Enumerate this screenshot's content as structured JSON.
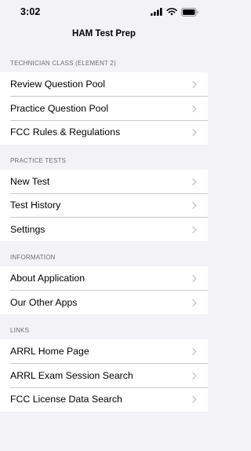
{
  "status_bar": {
    "time": "3:02",
    "icons": [
      "cellular-signal-icon",
      "wifi-icon",
      "battery-icon"
    ]
  },
  "nav": {
    "title": "HAM Test Prep"
  },
  "sections": [
    {
      "header": "TECHNICIAN CLASS (ELEMENT 2)",
      "items": [
        {
          "label": "Review Question Pool"
        },
        {
          "label": "Practice Question Pool"
        },
        {
          "label": "FCC Rules & Regulations"
        }
      ]
    },
    {
      "header": "PRACTICE TESTS",
      "items": [
        {
          "label": "New Test"
        },
        {
          "label": "Test History"
        },
        {
          "label": "Settings"
        }
      ]
    },
    {
      "header": "INFORMATION",
      "items": [
        {
          "label": "About Application"
        },
        {
          "label": "Our Other Apps"
        }
      ]
    },
    {
      "header": "LINKS",
      "items": [
        {
          "label": "ARRL Home Page"
        },
        {
          "label": "ARRL Exam Session Search"
        },
        {
          "label": "FCC License Data Search"
        }
      ]
    }
  ],
  "colors": {
    "background": "#f2f2f7",
    "row_background": "#ffffff",
    "header_text": "#6d6d72",
    "separator": "#c8c7cc",
    "chevron": "#c7c7cc"
  }
}
